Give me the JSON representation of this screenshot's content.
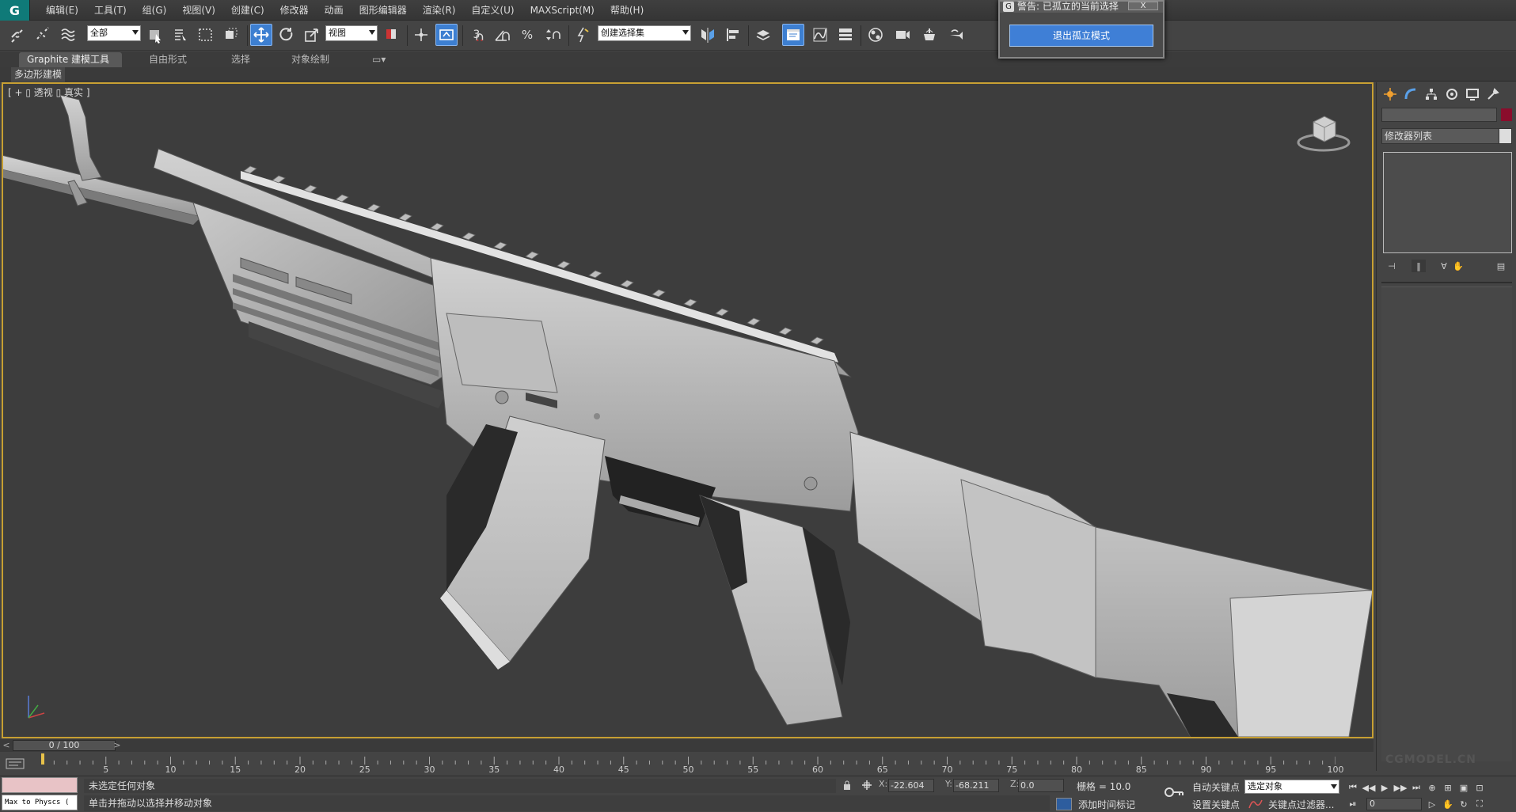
{
  "app": {
    "logo": "G"
  },
  "menu": [
    "编辑(E)",
    "工具(T)",
    "组(G)",
    "视图(V)",
    "创建(C)",
    "修改器",
    "动画",
    "图形编辑器",
    "渲染(R)",
    "自定义(U)",
    "MAXScript(M)",
    "帮助(H)"
  ],
  "toolbar": {
    "filter_value": "全部",
    "coord_system": "视图",
    "named_selection": "创建选择集",
    "snap_label": "3",
    "percent_label": "%"
  },
  "ribbon": {
    "tabs": [
      "Graphite 建模工具",
      "自由形式",
      "选择",
      "对象绘制"
    ],
    "active_index": 0,
    "sub_label": "多边形建模"
  },
  "viewport": {
    "label": "[ + ▯ 透视 ▯ 真实 ]",
    "border_color": "#c79f32",
    "background": "#3d3d3d"
  },
  "command_panel": {
    "modifier_list": "修改器列表",
    "object_color": "#8a0d2c"
  },
  "timeline": {
    "frame_display": "0 / 100",
    "ticks": [
      "5",
      "10",
      "15",
      "20",
      "25",
      "30",
      "35",
      "40",
      "45",
      "50",
      "55",
      "60",
      "65",
      "70",
      "75",
      "80",
      "85",
      "90",
      "95",
      "100"
    ]
  },
  "status": {
    "maxscript_text": "Max to Physcs (",
    "selection_status": "未选定任何对象",
    "prompt": "单击并拖动以选择并移动对象",
    "x_label": "X:",
    "x_value": "-22.604",
    "y_label": "Y:",
    "y_value": "-68.211",
    "z_label": "Z:",
    "z_value": "0.0",
    "grid": "栅格 = 10.0",
    "auto_key": "自动关键点",
    "set_key": "设置关键点",
    "selection_dropdown": "选定对象",
    "key_filters": "关键点过滤器...",
    "add_time_tag": "添加时间标记",
    "current_frame": "0"
  },
  "dialog": {
    "title": "警告: 已孤立的当前选择",
    "close_label": "X",
    "button_label": "退出孤立模式",
    "button_color": "#3f7fd6"
  },
  "watermark": "CGMODEL.CN"
}
